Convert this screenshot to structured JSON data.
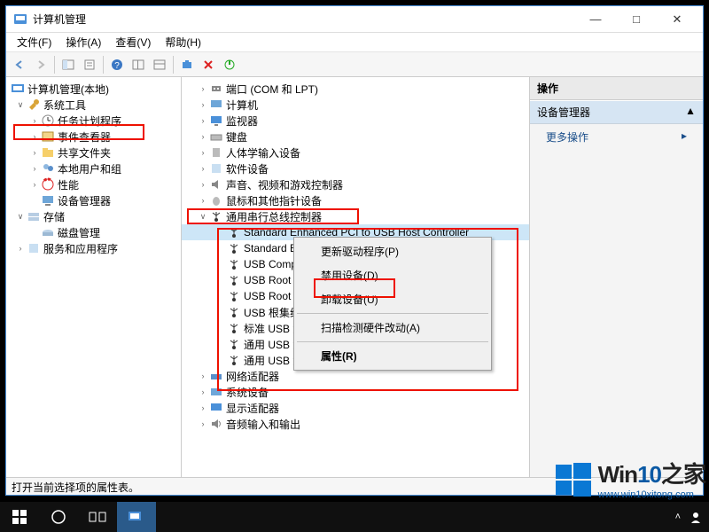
{
  "window": {
    "title": "计算机管理",
    "min": "—",
    "max": "□",
    "close": "✕"
  },
  "menu": {
    "file": "文件(F)",
    "operate": "操作(A)",
    "view": "查看(V)",
    "help": "帮助(H)"
  },
  "left_tree": {
    "root": "计算机管理(本地)",
    "sys_tools": "系统工具",
    "task_scheduler": "任务计划程序",
    "event_viewer": "事件查看器",
    "shared_folders": "共享文件夹",
    "local_users": "本地用户和组",
    "performance": "性能",
    "device_manager": "设备管理器",
    "storage": "存储",
    "disk_mgmt": "磁盘管理",
    "services_apps": "服务和应用程序"
  },
  "mid_tree": {
    "ports": "端口 (COM 和 LPT)",
    "computer": "计算机",
    "monitor": "监视器",
    "keyboard": "键盘",
    "hid": "人体学输入设备",
    "software": "软件设备",
    "sound": "声音、视频和游戏控制器",
    "mouse": "鼠标和其他指针设备",
    "usb_controllers": "通用串行总线控制器",
    "usb_items": [
      "Standard Enhanced PCI to USB Host Controller",
      "Standard Enhanced PCI to USB Host Controller",
      "USB Composite Device",
      "USB Root Hub",
      "USB Root Hub",
      "USB 根集线器",
      "标准 USB 集线器",
      "通用 USB 集线器",
      "通用 USB 集线器"
    ],
    "network": "网络适配器",
    "system_devices": "系统设备",
    "display": "显示适配器",
    "audio_io": "音频输入和输出"
  },
  "context_menu": {
    "update_driver": "更新驱动程序(P)",
    "disable": "禁用设备(D)",
    "uninstall": "卸载设备(U)",
    "scan": "扫描检测硬件改动(A)",
    "properties": "属性(R)"
  },
  "actions": {
    "header": "操作",
    "sub": "设备管理器",
    "more": "更多操作",
    "arrow": "▲",
    "chev": "▸"
  },
  "status": "打开当前选择项的属性表。",
  "watermark": {
    "brand_a": "Win",
    "brand_b": "10",
    "brand_c": "之家",
    "url": "www.win10xitong.com"
  }
}
